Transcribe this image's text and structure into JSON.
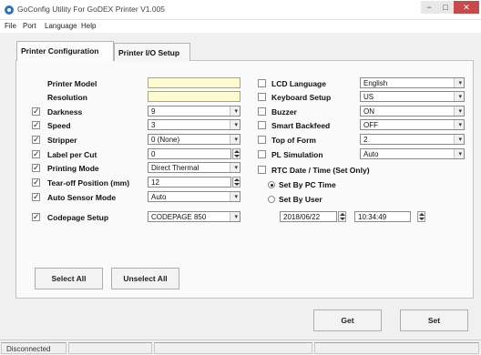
{
  "window": {
    "title": "GoConfig Utility For GoDEX Printer  V1.005"
  },
  "menu": [
    "File",
    "Port",
    "Language",
    "Help"
  ],
  "tabs": [
    {
      "label": "Printer Configuration",
      "active": true
    },
    {
      "label": "Printer I/O Setup",
      "active": false
    }
  ],
  "left_fields": [
    {
      "label": "Printer Model",
      "checked": null,
      "value": "",
      "kind": "text"
    },
    {
      "label": "Resolution",
      "checked": null,
      "value": "",
      "kind": "text"
    },
    {
      "label": "Darkness",
      "checked": true,
      "value": "9",
      "kind": "select"
    },
    {
      "label": "Speed",
      "checked": true,
      "value": "3",
      "kind": "select"
    },
    {
      "label": "Stripper",
      "checked": true,
      "value": "0 (None)",
      "kind": "select"
    },
    {
      "label": "Label per Cut",
      "checked": true,
      "value": "0",
      "kind": "spin"
    },
    {
      "label": "Printing Mode",
      "checked": true,
      "value": "Direct Thermal",
      "kind": "select"
    },
    {
      "label": "Tear-off Position (mm)",
      "checked": true,
      "value": "12",
      "kind": "spin"
    },
    {
      "label": "Auto Sensor Mode",
      "checked": true,
      "value": "Auto",
      "kind": "select"
    },
    {
      "label": "Codepage Setup",
      "checked": true,
      "value": "CODEPAGE 850",
      "kind": "select"
    }
  ],
  "right_fields": [
    {
      "label": "LCD Language",
      "checked": false,
      "value": "English"
    },
    {
      "label": "Keyboard Setup",
      "checked": false,
      "value": "US"
    },
    {
      "label": "Buzzer",
      "checked": false,
      "value": "ON"
    },
    {
      "label": "Smart Backfeed",
      "checked": false,
      "value": "OFF"
    },
    {
      "label": "Top of Form",
      "checked": false,
      "value": "2"
    },
    {
      "label": "PL Simulation",
      "checked": false,
      "value": "Auto"
    }
  ],
  "rtc": {
    "label": "RTC Date / Time (Set Only)",
    "checked": false,
    "options": [
      {
        "label": "Set By PC Time",
        "selected": true
      },
      {
        "label": "Set By User",
        "selected": false
      }
    ],
    "date": "2018/06/22",
    "time": "10:34:49"
  },
  "buttons": {
    "select_all": "Select All",
    "unselect_all": "Unselect All",
    "get": "Get",
    "set": "Set"
  },
  "status": {
    "connection": "Disconnected"
  },
  "window_buttons": {
    "min": "−",
    "max": "□",
    "close": "✕"
  }
}
